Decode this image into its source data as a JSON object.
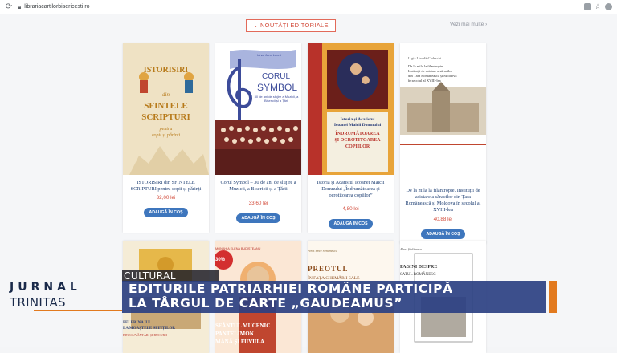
{
  "browser": {
    "url": "librariacartilorbisericesti.ro"
  },
  "section": {
    "title": "NOUTĂȚI EDITORIALE",
    "see_more": "Vezi mai multe"
  },
  "products": [
    {
      "title": "ISTORISIRI din SFINTELE SCRIPTURI pentru copii și părinți",
      "price": "32,00 lei",
      "button": "ADAUGĂ ÎN COȘ",
      "cover": {
        "line1": "ISTORISIRI",
        "line2": "din",
        "line3": "SFINTELE",
        "line4": "SCRIPTURI",
        "line5": "pentru",
        "line6": "copii și părinți"
      }
    },
    {
      "title": "Corul Symbol – 30 de ani de slujire a Muzicii, a Bisericii și a Țării",
      "price": "33,60 lei",
      "button": "ADAUGĂ ÎN COȘ",
      "cover": {
        "author": "Irina. Jane Leunt",
        "line1": "CORUL",
        "line2": "SYMBOL",
        "line3": "30 de ani de slujire a Muzicii, a Bisericii și a Țării"
      }
    },
    {
      "title": "Istoria și Acatistul Icoanei Maicii Domnului „Îndrumătoarea și ocrotitoarea copiilor”",
      "price": "4,80 lei",
      "button": "ADAUGĂ ÎN COȘ",
      "cover": {
        "line1": "Istoria și Acatistul",
        "line2": "Icoanei Maicii Domnului",
        "line3": "ÎNDRUMĂTOAREA",
        "line4": "ȘI OCROTITOAREA",
        "line5": "COPIILOR"
      }
    },
    {
      "title": "De la mila la filantropie. Instituții de asistare a săracilor din Țara Românească și Moldova în secolul al XVIII-lea",
      "price": "40,88 lei",
      "button": "ADAUGĂ ÎN COȘ",
      "cover": {
        "author": "Ligia Livadă-Cadeschi",
        "line1": "De la mila la filantropie.",
        "line2": "Instituții de asistare a săracilor",
        "line3": "din Țara Românească și Moldova",
        "line4": "în secolul al XVIII-lea"
      }
    }
  ],
  "row2": [
    {
      "line1": "PELERINAJUL",
      "line2": "LA MOAȘTELE SFINȚILOR",
      "line3": "BINECUVÂNTĂRI ȘI BUCURII"
    },
    {
      "badge": "-30%",
      "author": "MONAHIA ELENA BUDIȘTEANU",
      "line1": "SFÂNTUL MUCENIC",
      "line2": "PANTELIMON",
      "line3": "MÂNĂ ȘI FUVULA"
    },
    {
      "author": "Preot Petre Semenescu",
      "line1": "PREOTUL",
      "line2": "ÎN FAȚA CHEMĂRII SALE"
    },
    {
      "author": "Alex. Ștefănescu",
      "line1": "PAGINI DESPRE",
      "line2": "SATUL ROMÂNESC"
    }
  ],
  "overlay": {
    "category": "CULTURAL",
    "logo_top": "JURNAL",
    "logo_bottom": "TRINITAS",
    "headline_line1": "EDITURILE PATRIARHIEI ROMÂNE PARTICIPĂ",
    "headline_line2": "LA TÂRGUL DE CARTE „GAUDEAMUS”",
    "accent_color": "#e27a1f",
    "headline_bg": "#2b4082"
  }
}
